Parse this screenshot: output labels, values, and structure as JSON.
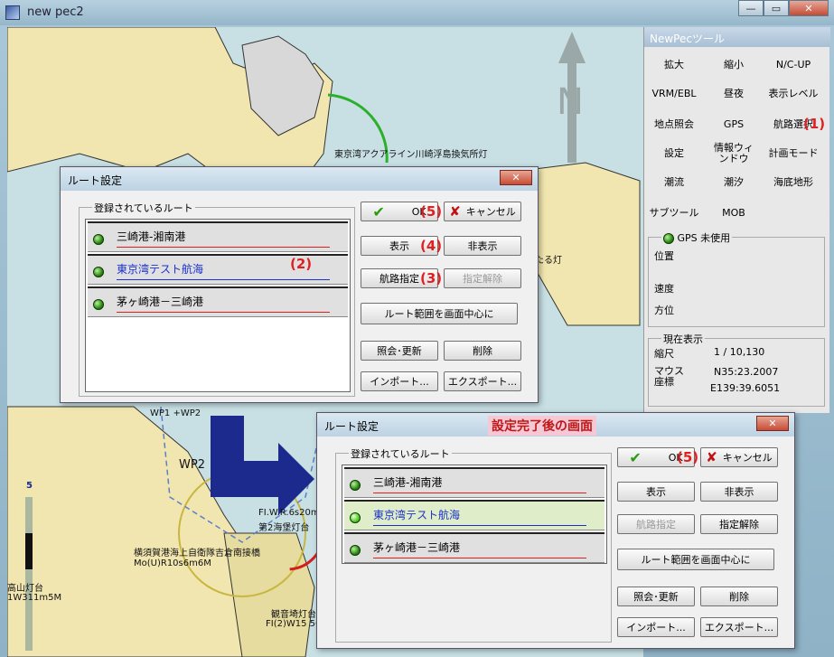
{
  "window": {
    "title": "new pec2",
    "min": "—",
    "max": "▭",
    "close": "✕"
  },
  "map": {
    "labels": {
      "light1": "東京湾アクアライン川崎浮島換気所灯",
      "light2": "たる灯",
      "wp1": "WP1 +WP2",
      "wp2": "WP2",
      "light3": "FI.W.R.6s20m",
      "light4": "第2海堡灯台",
      "light5": "横須賀港海上自衛隊吉倉南接橋",
      "light6": "Mo(U)R10s6m6M",
      "light7": "観音埼灯台",
      "light8": "FI(2)W15 56",
      "light9": "高山灯台",
      "light10": "1W311m5M",
      "scale": "5",
      "north": "N"
    }
  },
  "tool_panel": {
    "title": "NewPecツール",
    "buttons": [
      "拡大",
      "縮小",
      "N/C-UP",
      "VRM/EBL",
      "昼夜",
      "表示レベル",
      "地点照会",
      "GPS",
      "航路選択",
      "設定",
      "情報ウィンドウ",
      "計画モード",
      "潮流",
      "潮汐",
      "海底地形",
      "サブツール",
      "MOB"
    ],
    "marker1": "(1)",
    "gps": {
      "label": "GPS 未使用",
      "position": "位置",
      "speed": "速度",
      "heading": "方位"
    },
    "current": {
      "label": "現在表示",
      "scale_label": "縮尺",
      "scale_value": "1 / 10,130",
      "mouse_label": "マウス座標",
      "lat": "N35:23.2007",
      "lon": "E139:39.6051"
    }
  },
  "dialog1": {
    "title": "ルート設定",
    "close": "✕",
    "group_label": "登録されているルート",
    "routes": [
      {
        "name": "三崎港-湘南港",
        "color": "#e02020"
      },
      {
        "name": "東京湾テスト航海",
        "color": "#1a30d0"
      },
      {
        "name": "茅ヶ崎港－三崎港",
        "color": "#e02020"
      }
    ],
    "buttons": {
      "ok": "OK",
      "cancel": "キャンセル",
      "show": "表示",
      "hide": "非表示",
      "assign": "航路指定",
      "unassign": "指定解除",
      "center": "ルート範囲を画面中心に",
      "query": "照会･更新",
      "delete": "削除",
      "import": "インポート...",
      "export": "エクスポート..."
    },
    "annotations": {
      "a5": "(5)",
      "a4": "(4)",
      "a3": "(3)",
      "a2": "(2)"
    }
  },
  "dialog2": {
    "title": "ルート設定",
    "close": "✕",
    "caption": "設定完了後の画面",
    "group_label": "登録されているルート",
    "routes": [
      {
        "name": "三崎港-湘南港",
        "color": "#e02020"
      },
      {
        "name": "東京湾テスト航海",
        "color": "#1a30d0"
      },
      {
        "name": "茅ヶ崎港－三崎港",
        "color": "#e02020"
      }
    ],
    "buttons": {
      "ok": "OK",
      "cancel": "キャンセル",
      "show": "表示",
      "hide": "非表示",
      "assign": "航路指定",
      "unassign": "指定解除",
      "center": "ルート範囲を画面中心に",
      "query": "照会･更新",
      "delete": "削除",
      "import": "インポート...",
      "export": "エクスポート..."
    },
    "annotations": {
      "a5": "(5)"
    }
  },
  "colors": {
    "land": "#f2e6b0",
    "sea": "#c8e0e4",
    "arrow": "#1b2a8c"
  }
}
